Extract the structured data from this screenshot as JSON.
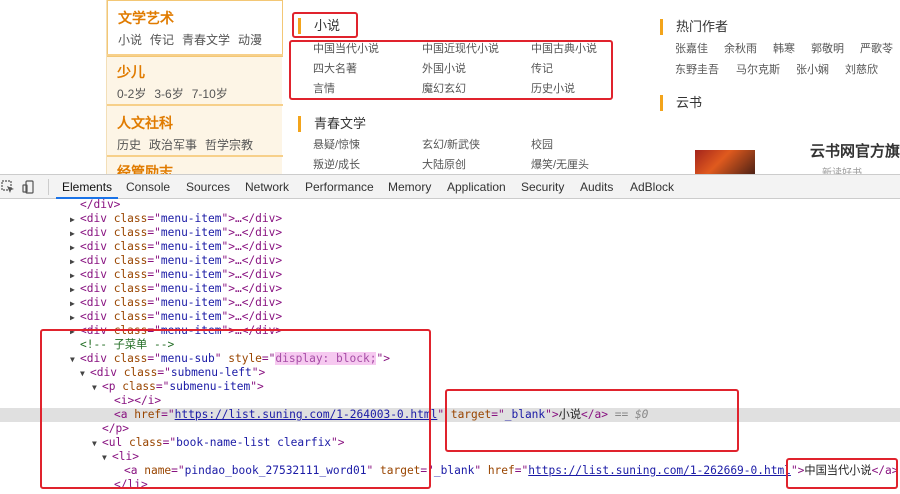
{
  "site": {
    "left_nav": [
      {
        "title": "文学艺术",
        "links": [
          "小说",
          "传记",
          "青春文学",
          "动漫"
        ]
      },
      {
        "title": "少儿",
        "links": [
          "0-2岁",
          "3-6岁",
          "7-10岁"
        ]
      },
      {
        "title": "人文社科",
        "links": [
          "历史",
          "政治军事",
          "哲学宗教"
        ]
      },
      {
        "title": "经管励志",
        "links": []
      }
    ],
    "fiction": {
      "title": "小说",
      "links": [
        "中国当代小说",
        "中国近现代小说",
        "中国古典小说",
        "四大名著",
        "外国小说",
        "传记",
        "言情",
        "魔幻玄幻",
        "历史小说"
      ]
    },
    "youth": {
      "title": "青春文学",
      "links": [
        "悬疑/惊悚",
        "玄幻/新武侠",
        "校园",
        "叛逆/成长",
        "大陆原创",
        "爆笑/无厘头"
      ]
    },
    "authors": {
      "title": "热门作者",
      "row1": [
        "张嘉佳",
        "余秋雨",
        "韩寒",
        "郭敬明",
        "严歌苓"
      ],
      "row2": [
        "东野圭吾",
        "马尔克斯",
        "张小娴",
        "刘慈欣"
      ]
    },
    "cloud": {
      "title": "云书",
      "banner_title": "云书网官方旗",
      "banner_sub": "新读好书"
    }
  },
  "devtools": {
    "tabs": [
      "Elements",
      "Console",
      "Sources",
      "Network",
      "Performance",
      "Memory",
      "Application",
      "Security",
      "Audits",
      "AdBlock"
    ],
    "dom": {
      "close_div": "</div>",
      "menu_item": {
        "open": "<div ",
        "attr": "class",
        "eq": "=\"",
        "value": "menu-item",
        "close": "\">…</div>"
      },
      "comment": "<!-- 子菜单 -->",
      "menu_sub": {
        "open": "<div ",
        "attr1": "class",
        "val1": "menu-sub",
        "attr2": "style",
        "val2": "display: block;",
        "end": ">"
      },
      "submenu_left": {
        "open": "<div ",
        "attr": "class",
        "val": "submenu-left",
        "end": ">"
      },
      "p_submenu": {
        "open": "<p ",
        "attr": "class",
        "val": "submenu-item",
        "end": ">"
      },
      "i_tag": "<i></i>",
      "a_novel": {
        "open": "<a ",
        "attr1": "href",
        "url": "https://list.suning.com/1-264003-0.html",
        "attr2": "target",
        "val2": "_blank",
        "text": "小说",
        "close": "</a>",
        "marker": "== $0"
      },
      "close_p": "</p>",
      "ul": {
        "open": "<ul ",
        "attr": "class",
        "val": "book-name-list clearfix",
        "end": ">"
      },
      "li": "<li>",
      "a_book": {
        "open": "<a ",
        "attr1": "name",
        "val1": "pindao_book_27532111_word01",
        "attr2": "target",
        "val2": "_blank",
        "attr3": "href",
        "url": "https://list.suning.com/1-262669-0.html",
        "text": "中国当代小说",
        "close": "</a>"
      },
      "close_li": "</li>"
    }
  }
}
